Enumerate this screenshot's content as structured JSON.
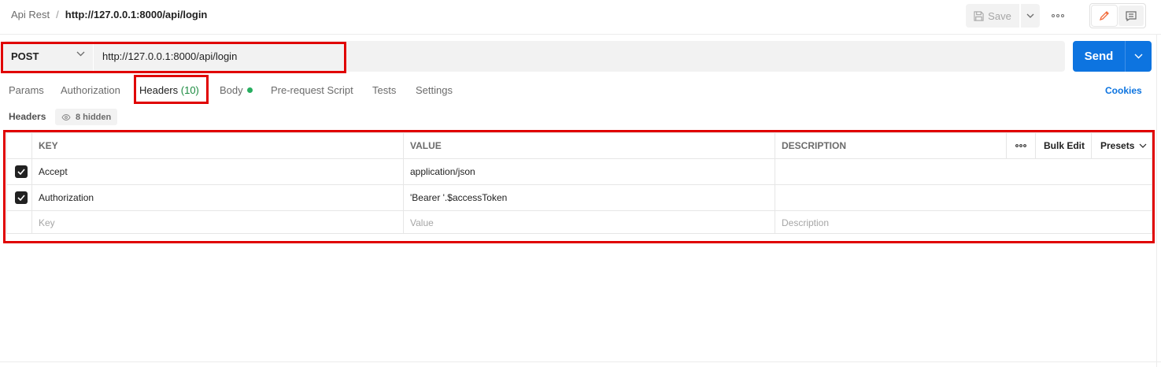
{
  "breadcrumb": {
    "parent": "Api Rest",
    "separator": "/",
    "current": "http://127.0.0.1:8000/api/login"
  },
  "toolbar": {
    "save_label": "Save",
    "more_icon": "ellipsis-icon",
    "edit_icon": "pencil-icon",
    "comments_icon": "comment-icon"
  },
  "request": {
    "method": "POST",
    "url": "http://127.0.0.1:8000/api/login",
    "send_label": "Send"
  },
  "tabs": [
    {
      "label": "Params"
    },
    {
      "label": "Authorization"
    },
    {
      "label": "Headers",
      "count": "(10)"
    },
    {
      "label": "Body"
    },
    {
      "label": "Pre-request Script"
    },
    {
      "label": "Tests"
    },
    {
      "label": "Settings"
    }
  ],
  "cookies_label": "Cookies",
  "headers_section": {
    "title": "Headers",
    "hidden_label": "8 hidden"
  },
  "table": {
    "columns": {
      "key": "KEY",
      "value": "VALUE",
      "description": "DESCRIPTION"
    },
    "bulk_edit": "Bulk Edit",
    "presets": "Presets",
    "rows": [
      {
        "checked": true,
        "key": "Accept",
        "value": "application/json",
        "description": ""
      },
      {
        "checked": true,
        "key": "Authorization",
        "value": "'Bearer '.$accessToken",
        "description": ""
      }
    ],
    "placeholder": {
      "key": "Key",
      "value": "Value",
      "description": "Description"
    }
  },
  "colors": {
    "accent": "#0d74e0",
    "highlight": "#e00000",
    "body_dot": "#27ae60",
    "count": "#1a8a3f"
  }
}
